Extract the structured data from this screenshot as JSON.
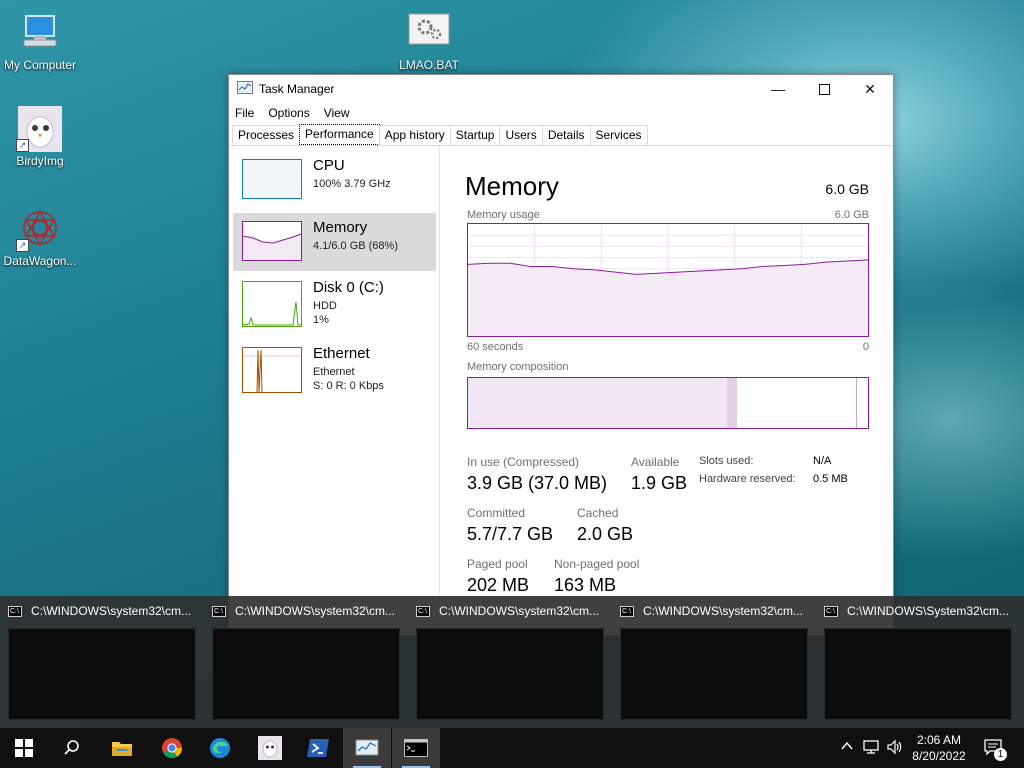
{
  "desktop": {
    "icons": [
      {
        "label": "My Computer",
        "icon": "computer-icon"
      },
      {
        "label": "LMAO.BAT",
        "icon": "batch-file-icon"
      },
      {
        "label": "BirdyImg",
        "icon": "image-shortcut-icon"
      },
      {
        "label": "DataWagon...",
        "icon": "datawagon-shortcut-icon"
      }
    ]
  },
  "window": {
    "title": "Task Manager",
    "menu": [
      "File",
      "Options",
      "View"
    ],
    "tabs": [
      "Processes",
      "Performance",
      "App history",
      "Startup",
      "Users",
      "Details",
      "Services"
    ],
    "active_tab": "Performance",
    "resources": [
      {
        "name": "CPU",
        "line1": "100%  3.79 GHz",
        "line2": "",
        "color": "#117dbb",
        "selected": false
      },
      {
        "name": "Memory",
        "line1": "4.1/6.0 GB (68%)",
        "line2": "",
        "color": "#8b1c9c",
        "selected": true
      },
      {
        "name": "Disk 0 (C:)",
        "line1": "HDD",
        "line2": "1%",
        "color": "#4da60c",
        "selected": false
      },
      {
        "name": "Ethernet",
        "line1": "Ethernet",
        "line2": "S: 0  R: 0 Kbps",
        "color": "#a74f01",
        "selected": false
      }
    ],
    "memory": {
      "title": "Memory",
      "capacity": "6.0 GB",
      "usage_label": "Memory usage",
      "usage_max": "6.0 GB",
      "time_left": "60 seconds",
      "time_right": "0",
      "composition_label": "Memory composition",
      "in_use_label": "In use (Compressed)",
      "in_use_value": "3.9 GB (37.0 MB)",
      "available_label": "Available",
      "available_value": "1.9 GB",
      "committed_label": "Committed",
      "committed_value": "5.7/7.7 GB",
      "cached_label": "Cached",
      "cached_value": "2.0 GB",
      "paged_label": "Paged pool",
      "paged_value": "202 MB",
      "nonpaged_label": "Non-paged pool",
      "nonpaged_value": "163 MB",
      "slots_label": "Slots used:",
      "slots_value": "N/A",
      "hw_label": "Hardware reserved:",
      "hw_value": "0.5 MB",
      "usage_history_fraction": [
        0.64,
        0.65,
        0.65,
        0.62,
        0.62,
        0.6,
        0.59,
        0.57,
        0.55,
        0.56,
        0.57,
        0.58,
        0.59,
        0.6,
        0.62,
        0.63,
        0.64,
        0.66,
        0.67,
        0.68
      ],
      "composition_fractions": {
        "in_use": 0.65,
        "modified": 0.025,
        "standby": 0.3,
        "free": 0.025
      }
    },
    "colors": {
      "memory": "#8b1c9c",
      "cpu": "#117dbb",
      "disk": "#4da60c",
      "ethernet": "#a74f01"
    }
  },
  "thumbnails": [
    {
      "title": "C:\\WINDOWS\\system32\\cm..."
    },
    {
      "title": "C:\\WINDOWS\\system32\\cm..."
    },
    {
      "title": "C:\\WINDOWS\\system32\\cm..."
    },
    {
      "title": "C:\\WINDOWS\\system32\\cm..."
    },
    {
      "title": "C:\\WINDOWS\\System32\\cm..."
    }
  ],
  "taskbar": {
    "apps": [
      "start-icon",
      "search-icon",
      "file-explorer-icon",
      "chrome-icon",
      "edge-icon",
      "birdyimg-icon",
      "powershell-icon",
      "task-manager-icon",
      "command-prompt-icon"
    ],
    "time": "2:06 AM",
    "date": "8/20/2022",
    "notification_count": "1"
  }
}
